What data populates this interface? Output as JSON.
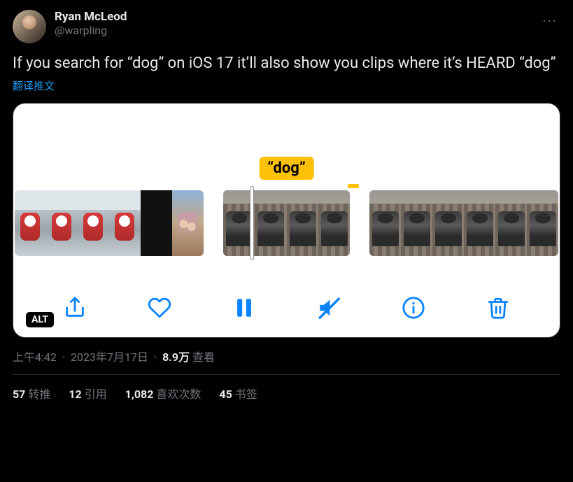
{
  "author": {
    "display_name": "Ryan McLeod",
    "handle": "@warpling"
  },
  "tweet_text": "If you search for “dog” on iOS 17 it’ll also show you clips where it’s HEARD “dog”",
  "translate_label": "翻译推文",
  "media": {
    "tooltip": "“dog”",
    "alt_badge": "ALT",
    "tools": {
      "share": "share-icon",
      "like": "heart-icon",
      "pause": "pause-icon",
      "mute": "mute-icon",
      "info": "info-icon",
      "trash": "trash-icon"
    }
  },
  "meta": {
    "time": "上午4:42",
    "date": "2023年7月17日",
    "views_count": "8.9万",
    "views_label": "查看"
  },
  "stats": {
    "retweets": {
      "count": "57",
      "label": "转推"
    },
    "quotes": {
      "count": "12",
      "label": "引用"
    },
    "likes": {
      "count": "1,082",
      "label": "喜欢次数"
    },
    "bookmarks": {
      "count": "45",
      "label": "书签"
    }
  },
  "more_btn": "···"
}
